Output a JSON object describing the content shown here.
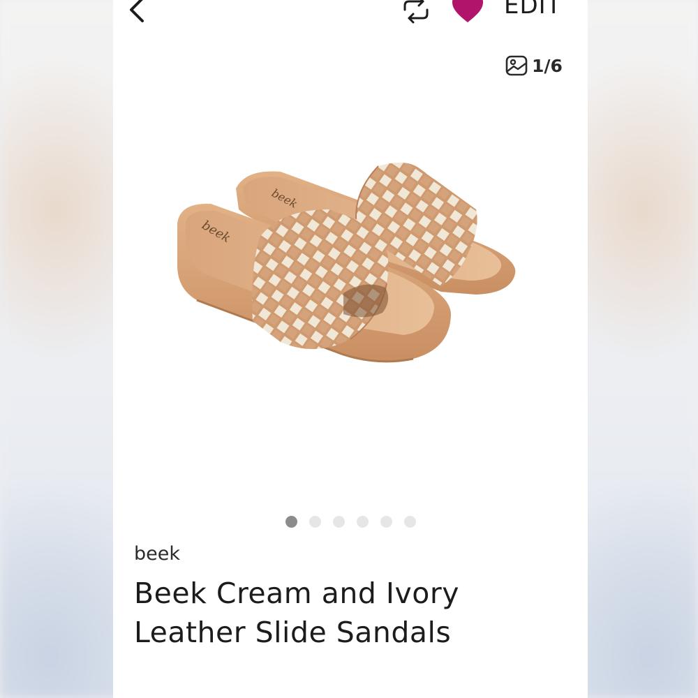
{
  "header": {
    "back_icon": "chevron-left-icon",
    "share_icon": "refresh-share-icon",
    "like_icon": "heart-icon",
    "edit_label": "EDIT"
  },
  "gallery": {
    "counter_icon": "image-icon",
    "counter_text": "1/6",
    "current_index": 1,
    "total_images": 6,
    "image_alt": "Woven leather slide sandals"
  },
  "product": {
    "brand": "beek",
    "title_line1": "Beek Cream and Ivory",
    "title_line2": "Leather Slide Sandals"
  },
  "colors": {
    "accent_heart": "#b0156b",
    "leather": "#d9a57a",
    "weave_cream": "#efe6d5",
    "dot_active": "#8c8c8c",
    "dot_inactive": "#e6e6e6"
  }
}
